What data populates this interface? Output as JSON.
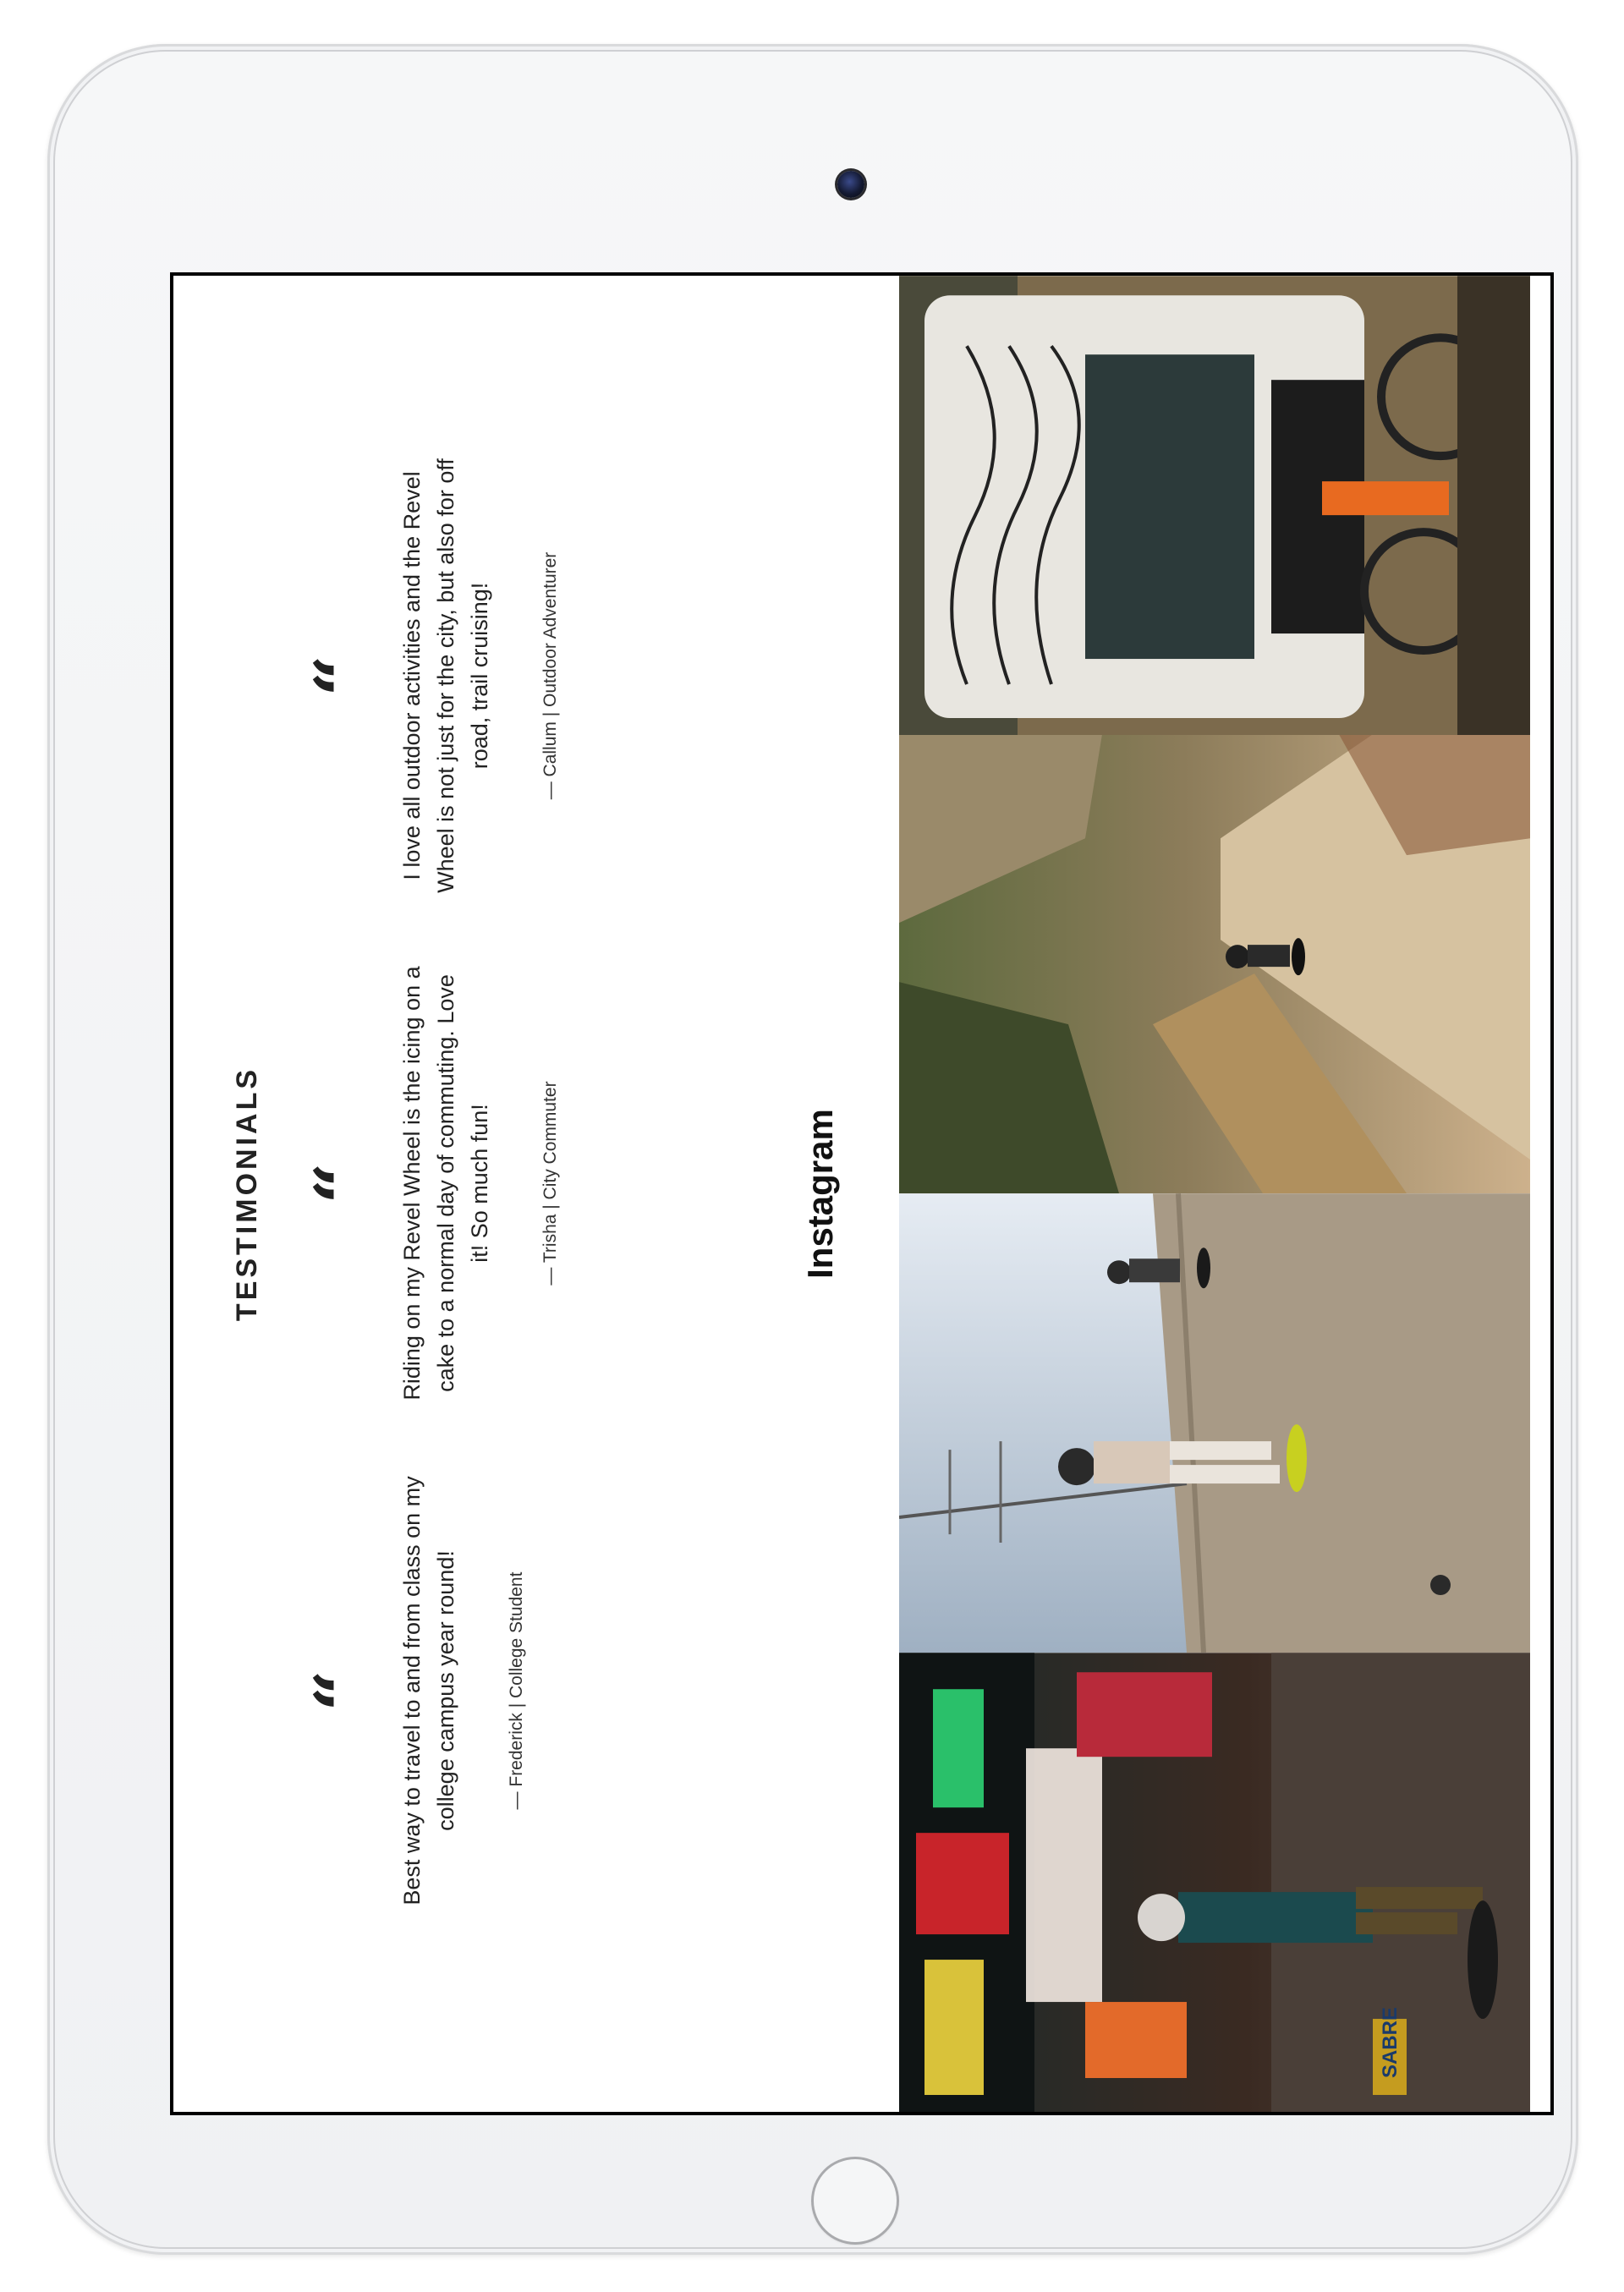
{
  "testimonials": {
    "title": "TESTIMONIALS",
    "quote_mark": "“",
    "items": [
      {
        "quote": "Best way to travel to and from class on my college campus year round!",
        "author": "— Frederick | College Student"
      },
      {
        "quote": "Riding on my Revel Wheel is the icing on a cake to a normal day of commuting. Love it! So much fun!",
        "author": "— Trisha | City Commuter"
      },
      {
        "quote": "I love all outdoor activities and the Revel Wheel is not just for the city, but also for off road, trail cruising!",
        "author": "— Callum | Outdoor Adventurer"
      }
    ]
  },
  "instagram": {
    "title": "Instagram",
    "photos": [
      {
        "name": "city-night-street-photo",
        "sign_text": "SABRE"
      },
      {
        "name": "skaters-road-photo"
      },
      {
        "name": "dirt-trail-rider-photo"
      },
      {
        "name": "van-with-bike-photo"
      }
    ]
  },
  "colors": {
    "text": "#222222",
    "frame": "#f3f4f6",
    "screen_border": "#1a1a1a"
  }
}
